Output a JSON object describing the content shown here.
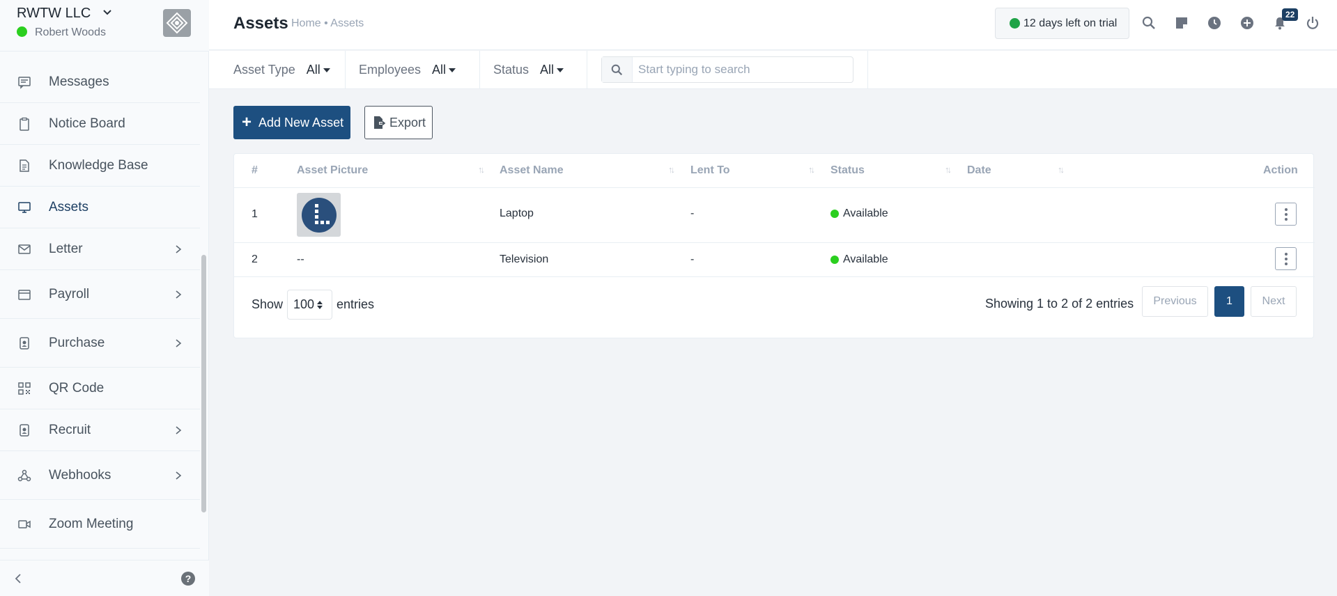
{
  "sidebar": {
    "company": "RWTW LLC",
    "user": "Robert Woods",
    "items": [
      {
        "label": "Messages",
        "icon": "messages-icon",
        "has_arrow": false
      },
      {
        "label": "Notice Board",
        "icon": "clipboard-icon",
        "has_arrow": false
      },
      {
        "label": "Knowledge Base",
        "icon": "document-icon",
        "has_arrow": false
      },
      {
        "label": "Assets",
        "icon": "monitor-icon",
        "has_arrow": false
      },
      {
        "label": "Letter",
        "icon": "envelope-icon",
        "has_arrow": true
      },
      {
        "label": "Payroll",
        "icon": "wallet-icon",
        "has_arrow": true
      },
      {
        "label": "Purchase",
        "icon": "badge-icon",
        "has_arrow": true
      },
      {
        "label": "QR Code",
        "icon": "qr-code-icon",
        "has_arrow": false
      },
      {
        "label": "Recruit",
        "icon": "id-card-icon",
        "has_arrow": true
      },
      {
        "label": "Webhooks",
        "icon": "webhook-icon",
        "has_arrow": true
      },
      {
        "label": "Zoom Meeting",
        "icon": "video-icon",
        "has_arrow": false
      }
    ]
  },
  "header": {
    "title": "Assets",
    "breadcrumb": "Home • Assets",
    "trial": "12 days left on trial",
    "notification_count": "22"
  },
  "filters": {
    "asset_type_label": "Asset Type",
    "asset_type_value": "All",
    "employees_label": "Employees",
    "employees_value": "All",
    "status_label": "Status",
    "status_value": "All",
    "search_placeholder": "Start typing to search"
  },
  "actions": {
    "add_label": "Add New Asset",
    "export_label": "Export"
  },
  "table": {
    "columns": {
      "num": "#",
      "picture": "Asset Picture",
      "name": "Asset Name",
      "lent_to": "Lent To",
      "status": "Status",
      "date": "Date",
      "action": "Action"
    },
    "rows": [
      {
        "num": "1",
        "picture": "",
        "name": "Laptop",
        "lent_to": "-",
        "status": "Available",
        "date": ""
      },
      {
        "num": "2",
        "picture": "--",
        "name": "Television",
        "lent_to": "-",
        "status": "Available",
        "date": ""
      }
    ],
    "show_label": "Show",
    "page_length": "100",
    "entries_label": "entries",
    "info": "Showing 1 to 2 of 2 entries",
    "prev": "Previous",
    "page": "1",
    "next": "Next"
  },
  "colors": {
    "primary": "#1d4f80",
    "available": "#2bcf1f",
    "trial_dot": "#1fa347"
  }
}
